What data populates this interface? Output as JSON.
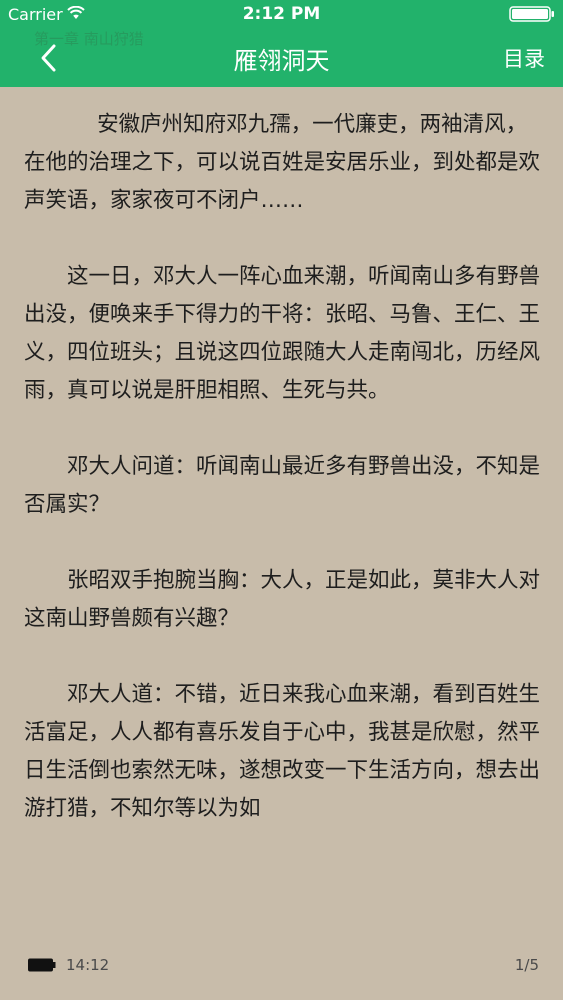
{
  "status_bar": {
    "carrier": "Carrier",
    "time": "2:12 PM"
  },
  "header": {
    "chapter_ghost": "第一章 南山狩猎",
    "title": "雁翎洞天",
    "catalog_label": "目录",
    "color": "#22b26b"
  },
  "content": {
    "paragraphs": [
      "安徽庐州知府邓九孺，一代廉吏，两袖清风，在他的治理之下，可以说百姓是安居乐业，到处都是欢声笑语，家家夜可不闭户……",
      "这一日，邓大人一阵心血来潮，听闻南山多有野兽出没，便唤来手下得力的干将：张昭、马鲁、王仁、王义，四位班头；且说这四位跟随大人走南闯北，历经风雨，真可以说是肝胆相照、生死与共。",
      "邓大人问道：听闻南山最近多有野兽出没，不知是否属实？",
      "张昭双手抱腕当胸：大人，正是如此，莫非大人对这南山野兽颇有兴趣？",
      "邓大人道：不错，近日来我心血来潮，看到百姓生活富足，人人都有喜乐发自于心中，我甚是欣慰，然平日生活倒也索然无味，遂想改变一下生活方向，想去出游打猎，不知尔等以为如"
    ],
    "background": "#c8bcaa"
  },
  "footer": {
    "time": "14:12",
    "page": "1/5"
  }
}
